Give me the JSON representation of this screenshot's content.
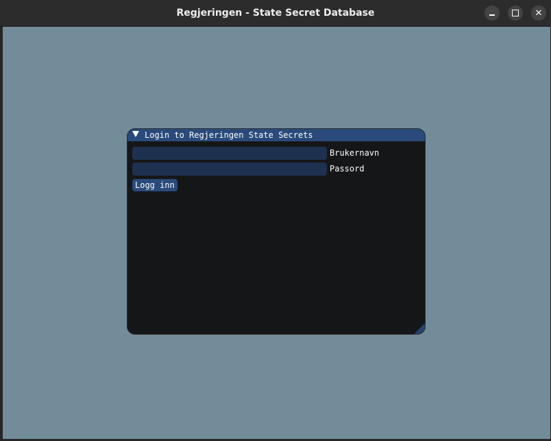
{
  "window": {
    "title": "Regjeringen - State Secret Database",
    "controls": {
      "minimize": "minimize",
      "maximize": "maximize",
      "close": "close"
    }
  },
  "login_panel": {
    "title": "Login to Regjeringen State Secrets",
    "username_label": "Brukernavn",
    "username_value": "",
    "password_label": "Passord",
    "password_value": "",
    "login_button": "Logg inn"
  },
  "colors": {
    "background": "#738c99",
    "panel": "#151617",
    "accent": "#294a7a",
    "input": "#1e3150"
  }
}
